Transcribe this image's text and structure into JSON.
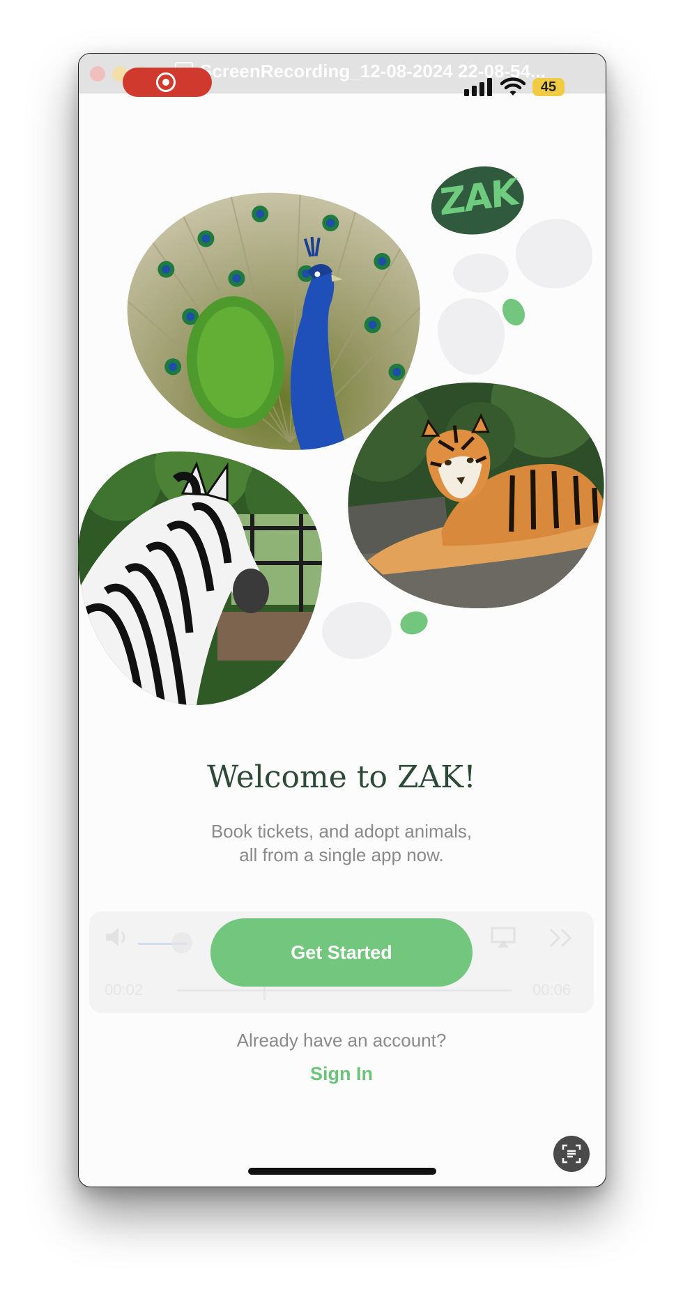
{
  "window": {
    "title": "ScreenRecording_12-08-2024 22-08-54..."
  },
  "status_bar": {
    "battery": "45"
  },
  "logo": {
    "text": "ZAK"
  },
  "gallery": {
    "images": [
      {
        "subject": "peacock"
      },
      {
        "subject": "zebra"
      },
      {
        "subject": "tiger"
      }
    ]
  },
  "welcome": {
    "title": "Welcome to ZAK!",
    "subtitle_line1": "Book tickets, and adopt animals,",
    "subtitle_line2": "all from a single app now."
  },
  "player_overlay": {
    "elapsed": "00:02",
    "remaining": "00:06"
  },
  "actions": {
    "get_started": "Get Started",
    "already_account": "Already have an account?",
    "sign_in": "Sign In"
  },
  "colors": {
    "brand_green": "#72c67e",
    "dark_green": "#2f5a3e",
    "record_red": "#d0392e",
    "battery_yellow": "#f1cb42"
  },
  "icons": [
    "record-icon",
    "cellular-signal-icon",
    "wifi-icon",
    "battery-icon",
    "live-text-scan-icon"
  ]
}
